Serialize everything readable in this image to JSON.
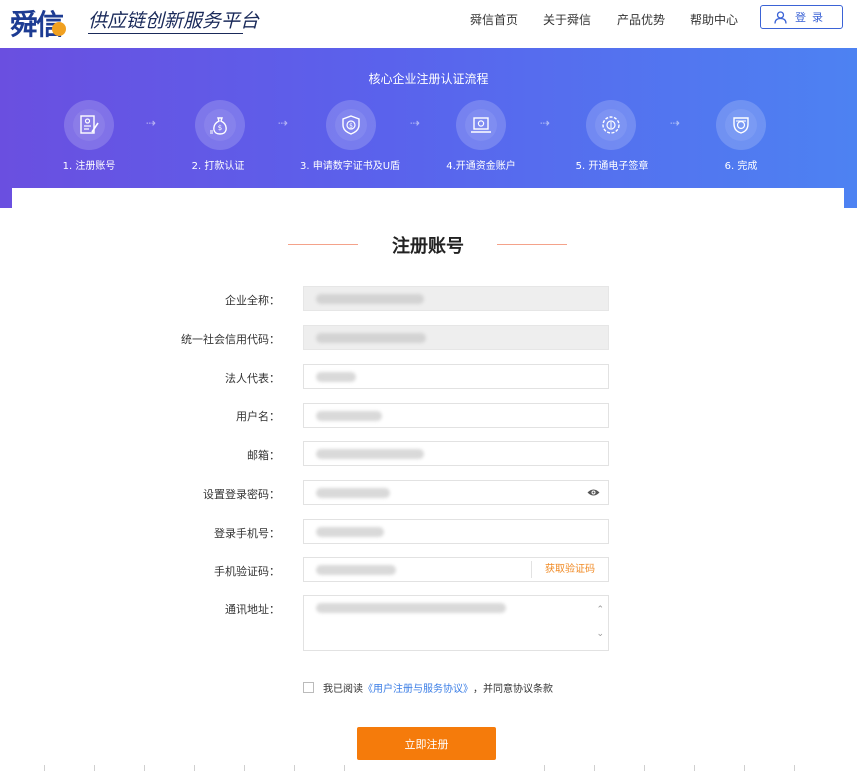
{
  "header": {
    "logo_text": "舜信",
    "slogan": "供应链创新服务平台",
    "nav": [
      "舜信首页",
      "关于舜信",
      "产品优势",
      "帮助中心"
    ],
    "login_label": "登录",
    "login_icon": "user-icon"
  },
  "banner": {
    "title": "核心企业注册认证流程",
    "steps": [
      {
        "label": "1. 注册账号",
        "icon": "register-document-icon"
      },
      {
        "label": "2. 打款认证",
        "icon": "money-bag-icon"
      },
      {
        "label": "3. 申请数字证书及U盾",
        "icon": "shield-certificate-icon"
      },
      {
        "label": "4.开通资金账户",
        "icon": "laptop-account-icon"
      },
      {
        "label": "5. 开通电子签章",
        "icon": "seal-stamp-icon"
      },
      {
        "label": "6. 完成",
        "icon": "completed-icon"
      }
    ],
    "arrow_glyph": "⇢"
  },
  "form": {
    "title": "注册账号",
    "fields": {
      "company_name": {
        "label": "企业全称："
      },
      "credit_code": {
        "label": "统一社会信用代码："
      },
      "legal_rep": {
        "label": "法人代表："
      },
      "username": {
        "label": "用户名："
      },
      "email": {
        "label": "邮箱："
      },
      "password": {
        "label": "设置登录密码："
      },
      "phone": {
        "label": "登录手机号："
      },
      "sms_code": {
        "label": "手机验证码：",
        "button": "获取验证码"
      },
      "address": {
        "label": "通讯地址："
      }
    },
    "agreement": {
      "prefix": "我已阅读",
      "link": "《用户注册与服务协议》",
      "suffix": "，并同意协议条款"
    },
    "submit_label": "立即注册"
  },
  "colors": {
    "brand_blue": "#1d3c93",
    "accent_orange": "#f57b0b",
    "link_blue": "#3b7ee6"
  }
}
